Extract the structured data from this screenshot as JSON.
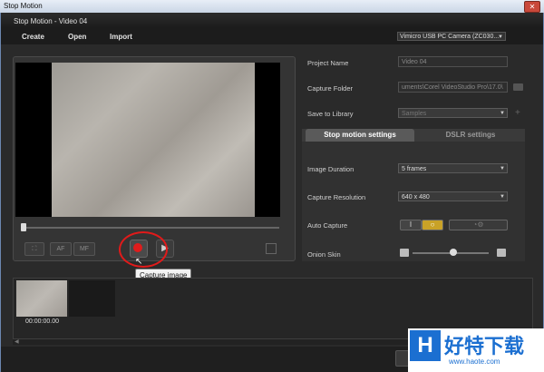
{
  "window": {
    "title": "Stop Motion",
    "close_label": "✕"
  },
  "dialog": {
    "title": "Stop Motion - Video 04"
  },
  "menu": {
    "items": [
      "Create",
      "Open",
      "Import"
    ]
  },
  "camera": {
    "selected": "Vimicro USB PC Camera (ZC030..."
  },
  "preview": {
    "af_label": "AF",
    "mf_label": "MF",
    "tooltip": "Capture image"
  },
  "right_panel": {
    "project_name_label": "Project Name",
    "project_name_value": "Video 04",
    "capture_folder_label": "Capture Folder",
    "capture_folder_value": "uments\\Corel VideoStudio Pro\\17.0\\",
    "save_to_library_label": "Save to Library",
    "save_to_library_value": "Samples",
    "tabs": [
      "Stop motion settings",
      "DSLR settings"
    ],
    "image_duration_label": "Image Duration",
    "image_duration_value": "5 frames",
    "capture_resolution_label": "Capture Resolution",
    "capture_resolution_value": "640 x 480",
    "auto_capture_label": "Auto Capture",
    "onion_skin_label": "Onion Skin"
  },
  "timeline": {
    "thumb_time": "00:00:00.00"
  },
  "watermark": {
    "cn": "好特下载",
    "url": "www.haote.com",
    "letter": "H"
  },
  "colors": {
    "record": "#e01c1c",
    "highlight": "#e11a1a",
    "brand": "#1b6fd1"
  }
}
